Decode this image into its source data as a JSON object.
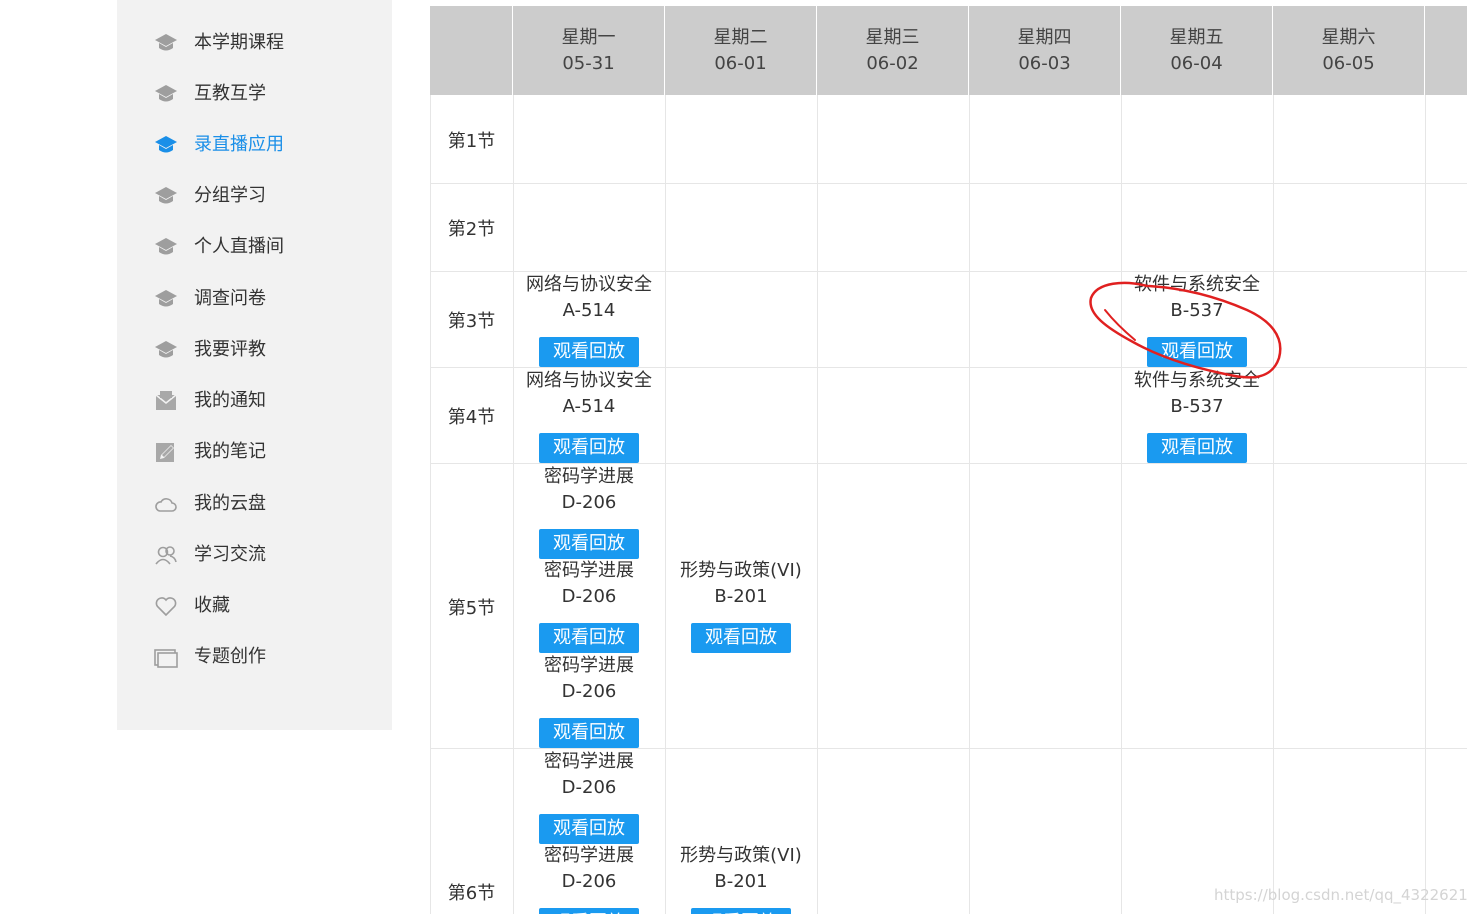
{
  "sidebar": {
    "items": [
      {
        "label": "本学期课程",
        "icon": "cap-icon",
        "active": false
      },
      {
        "label": "互教互学",
        "icon": "cap-icon",
        "active": false
      },
      {
        "label": "录直播应用",
        "icon": "cap-icon",
        "active": true
      },
      {
        "label": "分组学习",
        "icon": "cap-icon",
        "active": false
      },
      {
        "label": "个人直播间",
        "icon": "cap-icon",
        "active": false
      },
      {
        "label": "调查问卷",
        "icon": "cap-icon",
        "active": false
      },
      {
        "label": "我要评教",
        "icon": "cap-icon",
        "active": false
      },
      {
        "label": "我的通知",
        "icon": "mail-icon",
        "active": false
      },
      {
        "label": "我的笔记",
        "icon": "notepad-icon",
        "active": false
      },
      {
        "label": "我的云盘",
        "icon": "cloud-icon",
        "active": false
      },
      {
        "label": "学习交流",
        "icon": "users-icon",
        "active": false
      },
      {
        "label": "收藏",
        "icon": "heart-icon",
        "active": false
      },
      {
        "label": "专题创作",
        "icon": "window-icon",
        "active": false
      }
    ]
  },
  "schedule": {
    "days": [
      {
        "day": "星期一",
        "date": "05-31"
      },
      {
        "day": "星期二",
        "date": "06-01"
      },
      {
        "day": "星期三",
        "date": "06-02"
      },
      {
        "day": "星期四",
        "date": "06-03"
      },
      {
        "day": "星期五",
        "date": "06-04"
      },
      {
        "day": "星期六",
        "date": "06-05"
      }
    ],
    "periods": [
      "第1节",
      "第2节",
      "第3节",
      "第4节",
      "第5节",
      "第6节"
    ],
    "replay_label": "观看回放",
    "courses": [
      {
        "period": 2,
        "day": 0,
        "name": "网络与协议安全",
        "room": "A-514"
      },
      {
        "period": 2,
        "day": 4,
        "name": "软件与系统安全",
        "room": "B-537"
      },
      {
        "period": 3,
        "day": 0,
        "name": "网络与协议安全",
        "room": "A-514"
      },
      {
        "period": 3,
        "day": 4,
        "name": "软件与系统安全",
        "room": "B-537"
      },
      {
        "period": 4,
        "day": 0,
        "name": "密码学进展",
        "room": "D-206"
      },
      {
        "period": 4,
        "day": 0,
        "name": "密码学进展",
        "room": "D-206"
      },
      {
        "period": 4,
        "day": 1,
        "name": "形势与政策(VI)",
        "room": "B-201"
      },
      {
        "period": 4,
        "day": 0,
        "name": "密码学进展",
        "room": "D-206"
      },
      {
        "period": 5,
        "day": 0,
        "name": "密码学进展",
        "room": "D-206"
      },
      {
        "period": 5,
        "day": 0,
        "name": "密码学进展",
        "room": "D-206"
      },
      {
        "period": 5,
        "day": 1,
        "name": "形势与政策(VI)",
        "room": "B-201"
      }
    ]
  },
  "colors": {
    "accent": "#1a8fe8",
    "button": "#1a9af0",
    "header_bg": "#cccccc",
    "sidebar_bg": "#f2f2f2",
    "annotation": "#e02020"
  },
  "watermark": "https://blog.csdn.net/qq_43226213"
}
